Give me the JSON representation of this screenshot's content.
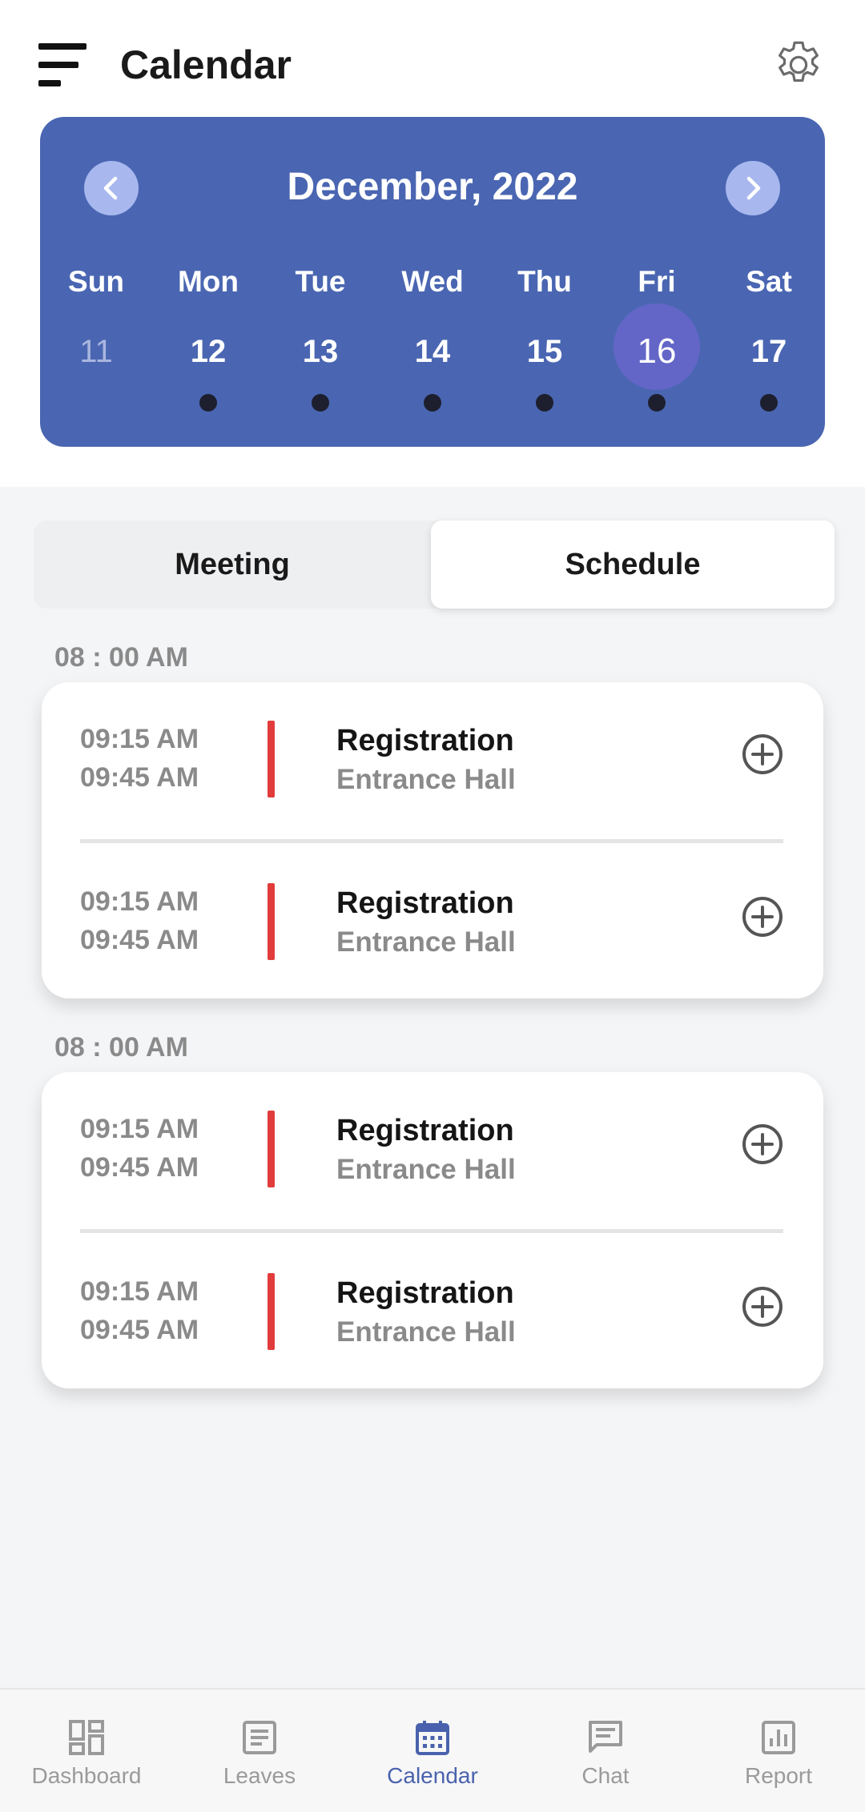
{
  "header": {
    "title": "Calendar",
    "menu_icon": "menu-icon",
    "settings_icon": "gear-icon"
  },
  "calendar": {
    "month": "December, 2022",
    "prev_icon": "chevron-left-icon",
    "next_icon": "chevron-right-icon",
    "weekdays": [
      "Sun",
      "Mon",
      "Tue",
      "Wed",
      "Thu",
      "Fri",
      "Sat"
    ],
    "days": [
      {
        "num": "11",
        "muted": true,
        "has_event": false
      },
      {
        "num": "12",
        "muted": false,
        "has_event": true
      },
      {
        "num": "13",
        "muted": false,
        "has_event": true
      },
      {
        "num": "14",
        "muted": false,
        "has_event": true
      },
      {
        "num": "15",
        "muted": false,
        "has_event": true
      },
      {
        "num": "16",
        "muted": false,
        "has_event": true,
        "selected": true
      },
      {
        "num": "17",
        "muted": false,
        "has_event": true
      }
    ],
    "selected_day": "16"
  },
  "tabs": {
    "meeting": "Meeting",
    "schedule": "Schedule",
    "active": "schedule"
  },
  "groups": [
    {
      "time": "08 : 00 AM",
      "events": [
        {
          "start": "09:15 AM",
          "end": "09:45 AM",
          "title": "Registration",
          "location": "Entrance Hall"
        },
        {
          "start": "09:15 AM",
          "end": "09:45 AM",
          "title": "Registration",
          "location": "Entrance Hall"
        }
      ]
    },
    {
      "time": "08 : 00 AM",
      "events": [
        {
          "start": "09:15 AM",
          "end": "09:45 AM",
          "title": "Registration",
          "location": "Entrance Hall"
        },
        {
          "start": "09:15 AM",
          "end": "09:45 AM",
          "title": "Registration",
          "location": "Entrance Hall"
        }
      ]
    }
  ],
  "bottom_nav": [
    {
      "label": "Dashboard",
      "icon": "dashboard-icon",
      "active": false
    },
    {
      "label": "Leaves",
      "icon": "leaves-icon",
      "active": false
    },
    {
      "label": "Calendar",
      "icon": "calendar-icon",
      "active": true
    },
    {
      "label": "Chat",
      "icon": "chat-icon",
      "active": false
    },
    {
      "label": "Report",
      "icon": "report-icon",
      "active": false
    }
  ],
  "colors": {
    "calendar_bg": "#4a66b2",
    "nav_button": "#a8b8ef",
    "selected_day": "#6366c7",
    "event_bar": "#e23b3b",
    "active_nav": "#4a62ad"
  }
}
